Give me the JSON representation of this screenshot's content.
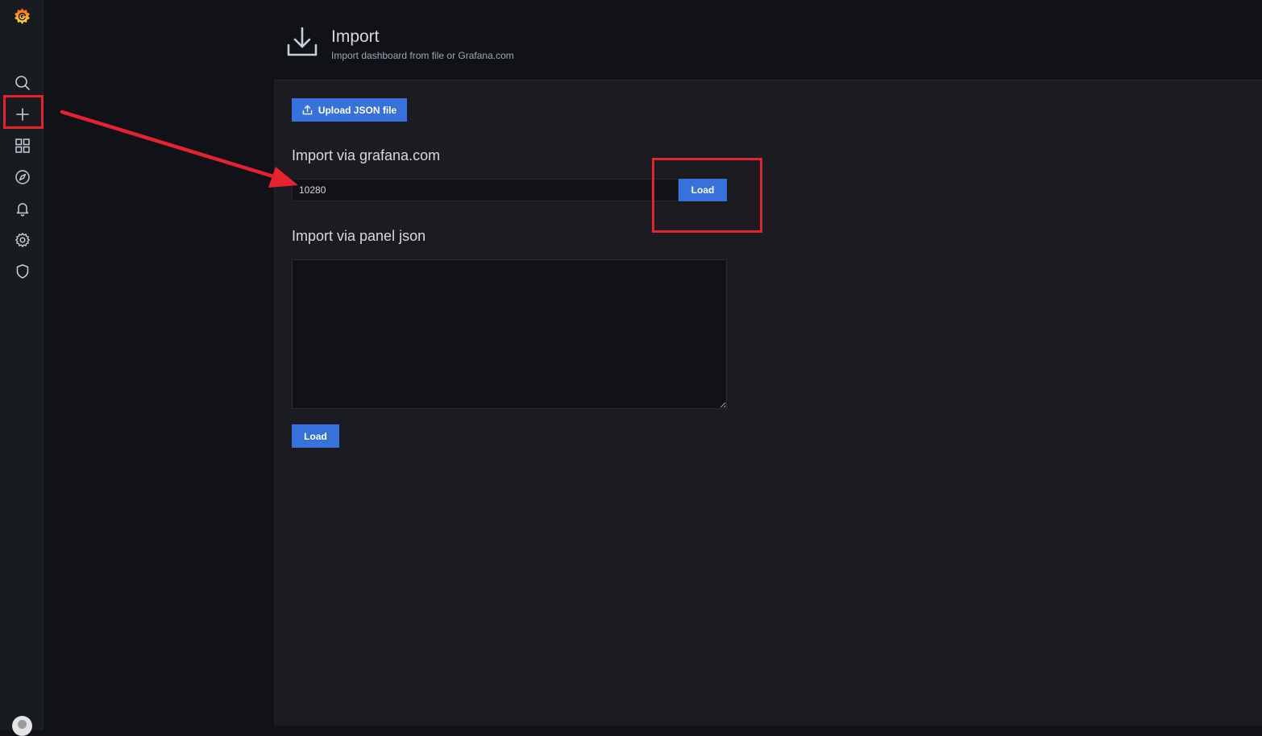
{
  "sidebar": {
    "logo": "grafana-logo",
    "items": [
      {
        "name": "search",
        "icon": "search-icon"
      },
      {
        "name": "create",
        "icon": "plus-icon"
      },
      {
        "name": "dashboards",
        "icon": "grid-icon"
      },
      {
        "name": "explore",
        "icon": "compass-icon"
      },
      {
        "name": "alerting",
        "icon": "bell-icon"
      },
      {
        "name": "configuration",
        "icon": "gear-icon"
      },
      {
        "name": "server-admin",
        "icon": "shield-icon"
      }
    ],
    "avatar": "user-avatar"
  },
  "header": {
    "icon": "download-icon",
    "title": "Import",
    "subtitle": "Import dashboard from file or Grafana.com"
  },
  "main": {
    "upload_label": "Upload JSON file",
    "grafana_section_title": "Import via grafana.com",
    "grafana_input_value": "10280",
    "grafana_load_label": "Load",
    "panel_json_title": "Import via panel json",
    "panel_json_value": "",
    "panel_load_label": "Load"
  },
  "colors": {
    "accent": "#3871dc",
    "annotation": "#e5222d",
    "background": "#111217",
    "panel": "#1a1c21"
  }
}
